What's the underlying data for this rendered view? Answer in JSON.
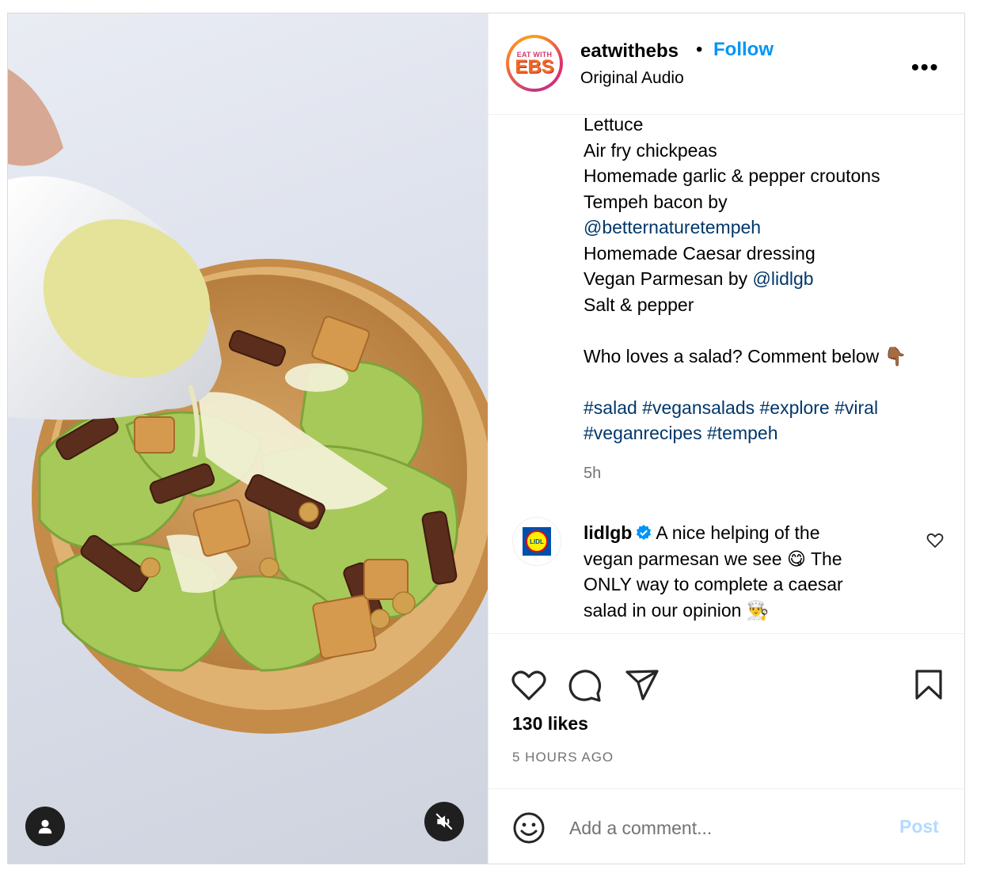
{
  "header": {
    "username": "eatwithebs",
    "separator": "•",
    "follow_label": "Follow",
    "audio": "Original Audio",
    "avatar_logo_top": "EAT WITH",
    "avatar_logo_main": "EBS",
    "more_label": "•••"
  },
  "caption": {
    "lines": [
      "Lettuce",
      "Air fry chickpeas",
      "Homemade garlic & pepper croutons",
      "Tempeh bacon by",
      "@betternaturetempeh",
      "Homemade Caesar dressing",
      "Salt & pepper"
    ],
    "parmesan_prefix": "Vegan Parmesan by ",
    "parmesan_mention": "@lidlgb",
    "question": "Who loves a salad? Comment below 👇🏾",
    "hashtags_line1": "#salad #vegansalads #explore #viral",
    "hashtags_line2": "#veganrecipes #tempeh",
    "time": "5h"
  },
  "comment": {
    "username": "lidlgb",
    "avatar_text": "LIDL",
    "line1": "A nice helping of the",
    "line2": "vegan parmesan we see 😋 The",
    "line3": "ONLY way to complete a caesar",
    "line4": "salad in our opinion 👨‍🍳"
  },
  "stats": {
    "likes": "130 likes",
    "posted_ago": "5 HOURS AGO"
  },
  "add_comment": {
    "placeholder": "Add a comment...",
    "post_label": "Post"
  },
  "icons": {
    "media_user": "user-icon",
    "media_mute": "muted-speaker-icon",
    "like": "heart-icon",
    "comment": "comment-bubble-icon",
    "share": "paper-plane-icon",
    "save": "bookmark-icon",
    "emoji": "smiley-icon",
    "verified": "verified-badge-icon"
  },
  "colors": {
    "follow": "#0095f6",
    "mention": "#00376b",
    "post_disabled": "#b3dbff",
    "muted_text": "#737373",
    "border": "#dbdbdb"
  }
}
